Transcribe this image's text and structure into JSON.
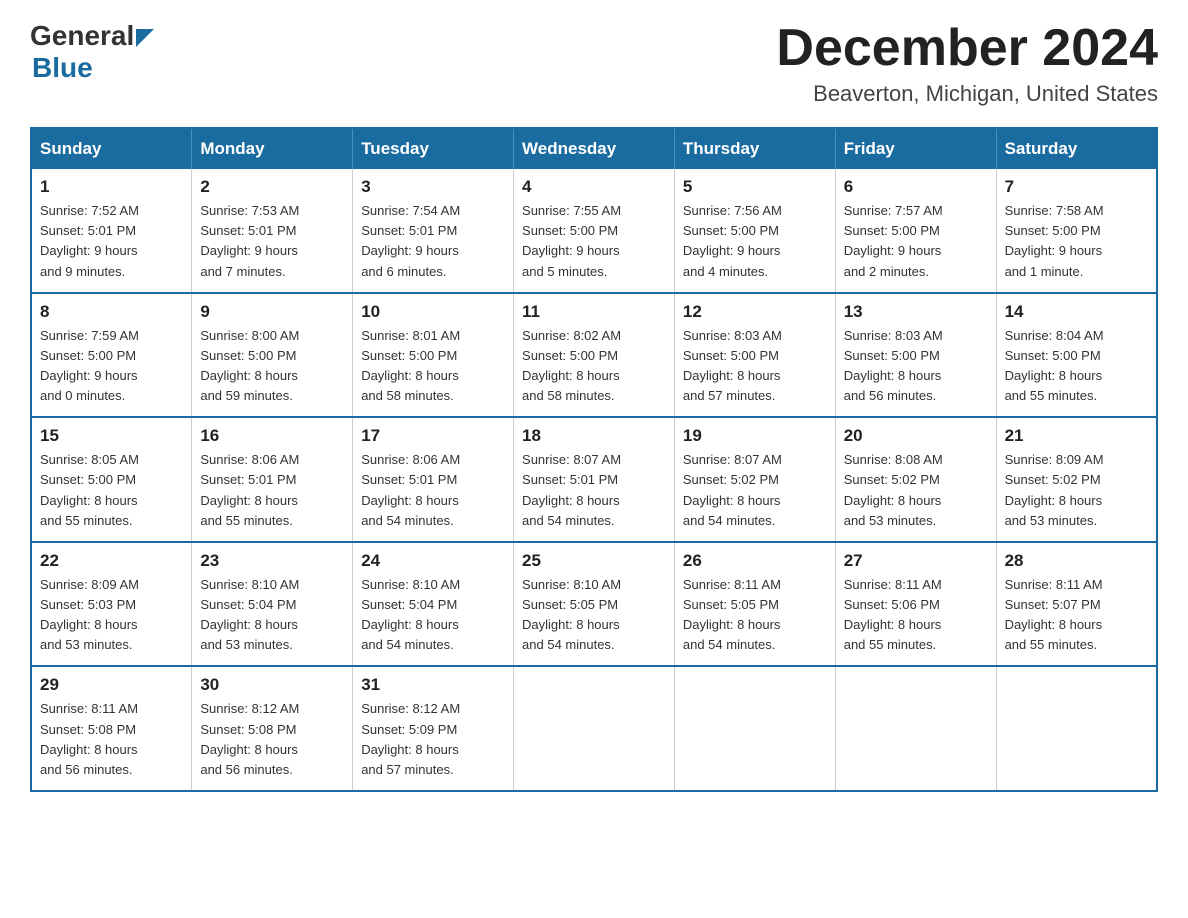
{
  "logo": {
    "general_text": "General",
    "blue_text": "Blue"
  },
  "title": "December 2024",
  "subtitle": "Beaverton, Michigan, United States",
  "days_of_week": [
    "Sunday",
    "Monday",
    "Tuesday",
    "Wednesday",
    "Thursday",
    "Friday",
    "Saturday"
  ],
  "weeks": [
    [
      {
        "day": "1",
        "sunrise": "7:52 AM",
        "sunset": "5:01 PM",
        "daylight": "9 hours and 9 minutes."
      },
      {
        "day": "2",
        "sunrise": "7:53 AM",
        "sunset": "5:01 PM",
        "daylight": "9 hours and 7 minutes."
      },
      {
        "day": "3",
        "sunrise": "7:54 AM",
        "sunset": "5:01 PM",
        "daylight": "9 hours and 6 minutes."
      },
      {
        "day": "4",
        "sunrise": "7:55 AM",
        "sunset": "5:00 PM",
        "daylight": "9 hours and 5 minutes."
      },
      {
        "day": "5",
        "sunrise": "7:56 AM",
        "sunset": "5:00 PM",
        "daylight": "9 hours and 4 minutes."
      },
      {
        "day": "6",
        "sunrise": "7:57 AM",
        "sunset": "5:00 PM",
        "daylight": "9 hours and 2 minutes."
      },
      {
        "day": "7",
        "sunrise": "7:58 AM",
        "sunset": "5:00 PM",
        "daylight": "9 hours and 1 minute."
      }
    ],
    [
      {
        "day": "8",
        "sunrise": "7:59 AM",
        "sunset": "5:00 PM",
        "daylight": "9 hours and 0 minutes."
      },
      {
        "day": "9",
        "sunrise": "8:00 AM",
        "sunset": "5:00 PM",
        "daylight": "8 hours and 59 minutes."
      },
      {
        "day": "10",
        "sunrise": "8:01 AM",
        "sunset": "5:00 PM",
        "daylight": "8 hours and 58 minutes."
      },
      {
        "day": "11",
        "sunrise": "8:02 AM",
        "sunset": "5:00 PM",
        "daylight": "8 hours and 58 minutes."
      },
      {
        "day": "12",
        "sunrise": "8:03 AM",
        "sunset": "5:00 PM",
        "daylight": "8 hours and 57 minutes."
      },
      {
        "day": "13",
        "sunrise": "8:03 AM",
        "sunset": "5:00 PM",
        "daylight": "8 hours and 56 minutes."
      },
      {
        "day": "14",
        "sunrise": "8:04 AM",
        "sunset": "5:00 PM",
        "daylight": "8 hours and 55 minutes."
      }
    ],
    [
      {
        "day": "15",
        "sunrise": "8:05 AM",
        "sunset": "5:00 PM",
        "daylight": "8 hours and 55 minutes."
      },
      {
        "day": "16",
        "sunrise": "8:06 AM",
        "sunset": "5:01 PM",
        "daylight": "8 hours and 55 minutes."
      },
      {
        "day": "17",
        "sunrise": "8:06 AM",
        "sunset": "5:01 PM",
        "daylight": "8 hours and 54 minutes."
      },
      {
        "day": "18",
        "sunrise": "8:07 AM",
        "sunset": "5:01 PM",
        "daylight": "8 hours and 54 minutes."
      },
      {
        "day": "19",
        "sunrise": "8:07 AM",
        "sunset": "5:02 PM",
        "daylight": "8 hours and 54 minutes."
      },
      {
        "day": "20",
        "sunrise": "8:08 AM",
        "sunset": "5:02 PM",
        "daylight": "8 hours and 53 minutes."
      },
      {
        "day": "21",
        "sunrise": "8:09 AM",
        "sunset": "5:02 PM",
        "daylight": "8 hours and 53 minutes."
      }
    ],
    [
      {
        "day": "22",
        "sunrise": "8:09 AM",
        "sunset": "5:03 PM",
        "daylight": "8 hours and 53 minutes."
      },
      {
        "day": "23",
        "sunrise": "8:10 AM",
        "sunset": "5:04 PM",
        "daylight": "8 hours and 53 minutes."
      },
      {
        "day": "24",
        "sunrise": "8:10 AM",
        "sunset": "5:04 PM",
        "daylight": "8 hours and 54 minutes."
      },
      {
        "day": "25",
        "sunrise": "8:10 AM",
        "sunset": "5:05 PM",
        "daylight": "8 hours and 54 minutes."
      },
      {
        "day": "26",
        "sunrise": "8:11 AM",
        "sunset": "5:05 PM",
        "daylight": "8 hours and 54 minutes."
      },
      {
        "day": "27",
        "sunrise": "8:11 AM",
        "sunset": "5:06 PM",
        "daylight": "8 hours and 55 minutes."
      },
      {
        "day": "28",
        "sunrise": "8:11 AM",
        "sunset": "5:07 PM",
        "daylight": "8 hours and 55 minutes."
      }
    ],
    [
      {
        "day": "29",
        "sunrise": "8:11 AM",
        "sunset": "5:08 PM",
        "daylight": "8 hours and 56 minutes."
      },
      {
        "day": "30",
        "sunrise": "8:12 AM",
        "sunset": "5:08 PM",
        "daylight": "8 hours and 56 minutes."
      },
      {
        "day": "31",
        "sunrise": "8:12 AM",
        "sunset": "5:09 PM",
        "daylight": "8 hours and 57 minutes."
      },
      null,
      null,
      null,
      null
    ]
  ],
  "labels": {
    "sunrise": "Sunrise:",
    "sunset": "Sunset:",
    "daylight": "Daylight:"
  }
}
